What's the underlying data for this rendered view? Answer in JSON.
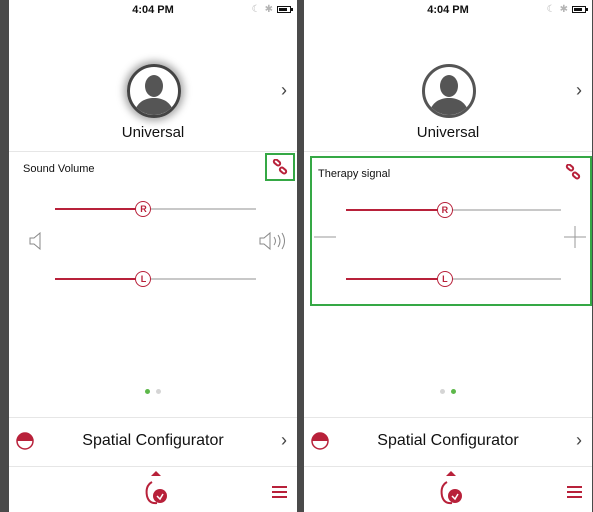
{
  "theme": {
    "accent": "#b8213a",
    "active_highlight": "#35a845",
    "page_dot_active": "#5db84a"
  },
  "screens": [
    {
      "status": {
        "time": "4:04 PM",
        "icons": [
          "moon-icon",
          "bluetooth-icon",
          "battery-icon"
        ]
      },
      "profile": {
        "name": "Universal",
        "avatar_icon": "person-silhouette-icon",
        "chevron": "›"
      },
      "control": {
        "title": "Sound Volume",
        "link_icon": "chain-link-icon",
        "highlighted": "link-button",
        "sliders": [
          {
            "label": "R",
            "side": "right",
            "level": 0.44
          },
          {
            "label": "L",
            "side": "left",
            "level": 0.44
          }
        ],
        "left_icon": "speaker-low-icon",
        "right_icon": "speaker-high-icon"
      },
      "pages": {
        "count": 2,
        "active": 0
      },
      "bottom": {
        "label": "Spatial Configurator",
        "icon": "spatial-configurator-icon",
        "chevron": "›",
        "menu_icon": "hamburger-menu-icon"
      }
    },
    {
      "status": {
        "time": "4:04 PM",
        "icons": [
          "moon-icon",
          "bluetooth-icon",
          "battery-icon"
        ]
      },
      "profile": {
        "name": "Universal",
        "avatar_icon": "person-silhouette-icon",
        "chevron": "›"
      },
      "control": {
        "title": "Therapy signal",
        "link_icon": "chain-link-icon",
        "highlighted": "panel",
        "sliders": [
          {
            "label": "R",
            "side": "right",
            "level": 0.46
          },
          {
            "label": "L",
            "side": "left",
            "level": 0.46
          }
        ],
        "left_icon": "minus-icon",
        "right_icon": "plus-icon"
      },
      "pages": {
        "count": 2,
        "active": 1
      },
      "bottom": {
        "label": "Spatial Configurator",
        "icon": "spatial-configurator-icon",
        "chevron": "›",
        "menu_icon": "hamburger-menu-icon"
      }
    }
  ]
}
